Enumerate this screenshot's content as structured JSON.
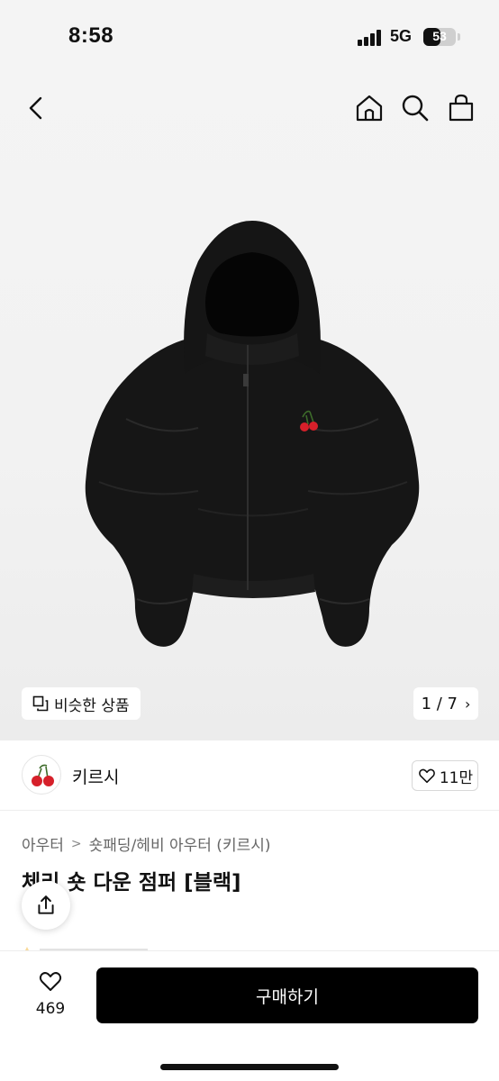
{
  "status_bar": {
    "time": "8:58",
    "network": "5G",
    "battery_level": "53",
    "battery_fraction": 0.53
  },
  "nav": {
    "back_icon": "chevron-left-icon",
    "home_icon": "home-icon",
    "search_icon": "search-icon",
    "cart_icon": "shopping-bag-icon"
  },
  "gallery": {
    "similar_label": "비슷한 상품",
    "current_page": "1",
    "total_pages": "7",
    "counter_separator": " / "
  },
  "brand": {
    "name": "키르시",
    "likes": "11만"
  },
  "breadcrumb": {
    "category": "아우터",
    "subcategory": "숏패딩/헤비 아우터 (키르시)"
  },
  "product": {
    "title": "체리 숏 다운 점퍼 [블랙]"
  },
  "bottom_bar": {
    "wish_count": "469",
    "buy_label": "구매하기"
  },
  "colors": {
    "accent": "#000000",
    "cherry": "#d6202a",
    "jacket": "#161616"
  }
}
